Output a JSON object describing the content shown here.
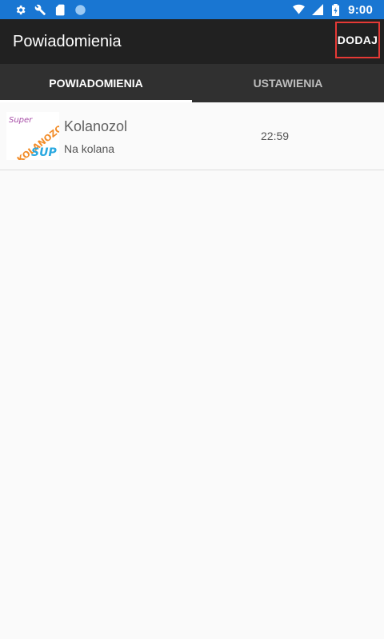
{
  "status_bar": {
    "time": "9:00",
    "color": "#1976d2",
    "icons_left": [
      "gear-icon",
      "wrench-icon",
      "sd-card-icon",
      "circle-icon"
    ],
    "icons_right": [
      "wifi-icon",
      "signal-icon",
      "battery-charging-icon"
    ]
  },
  "app_bar": {
    "title": "Powiadomienia",
    "action_label": "DODAJ",
    "background": "#212121"
  },
  "tabs": [
    {
      "label": "POWIADOMIENIA",
      "active": true
    },
    {
      "label": "USTAWIENIA",
      "active": false
    }
  ],
  "notifications": [
    {
      "title": "Kolanozol",
      "subtitle": "Na kolana",
      "time": "22:59",
      "thumbnail": {
        "text_top": "Super",
        "text_middle": "KOLANOZOL",
        "text_bottom": "SUP"
      }
    }
  ]
}
